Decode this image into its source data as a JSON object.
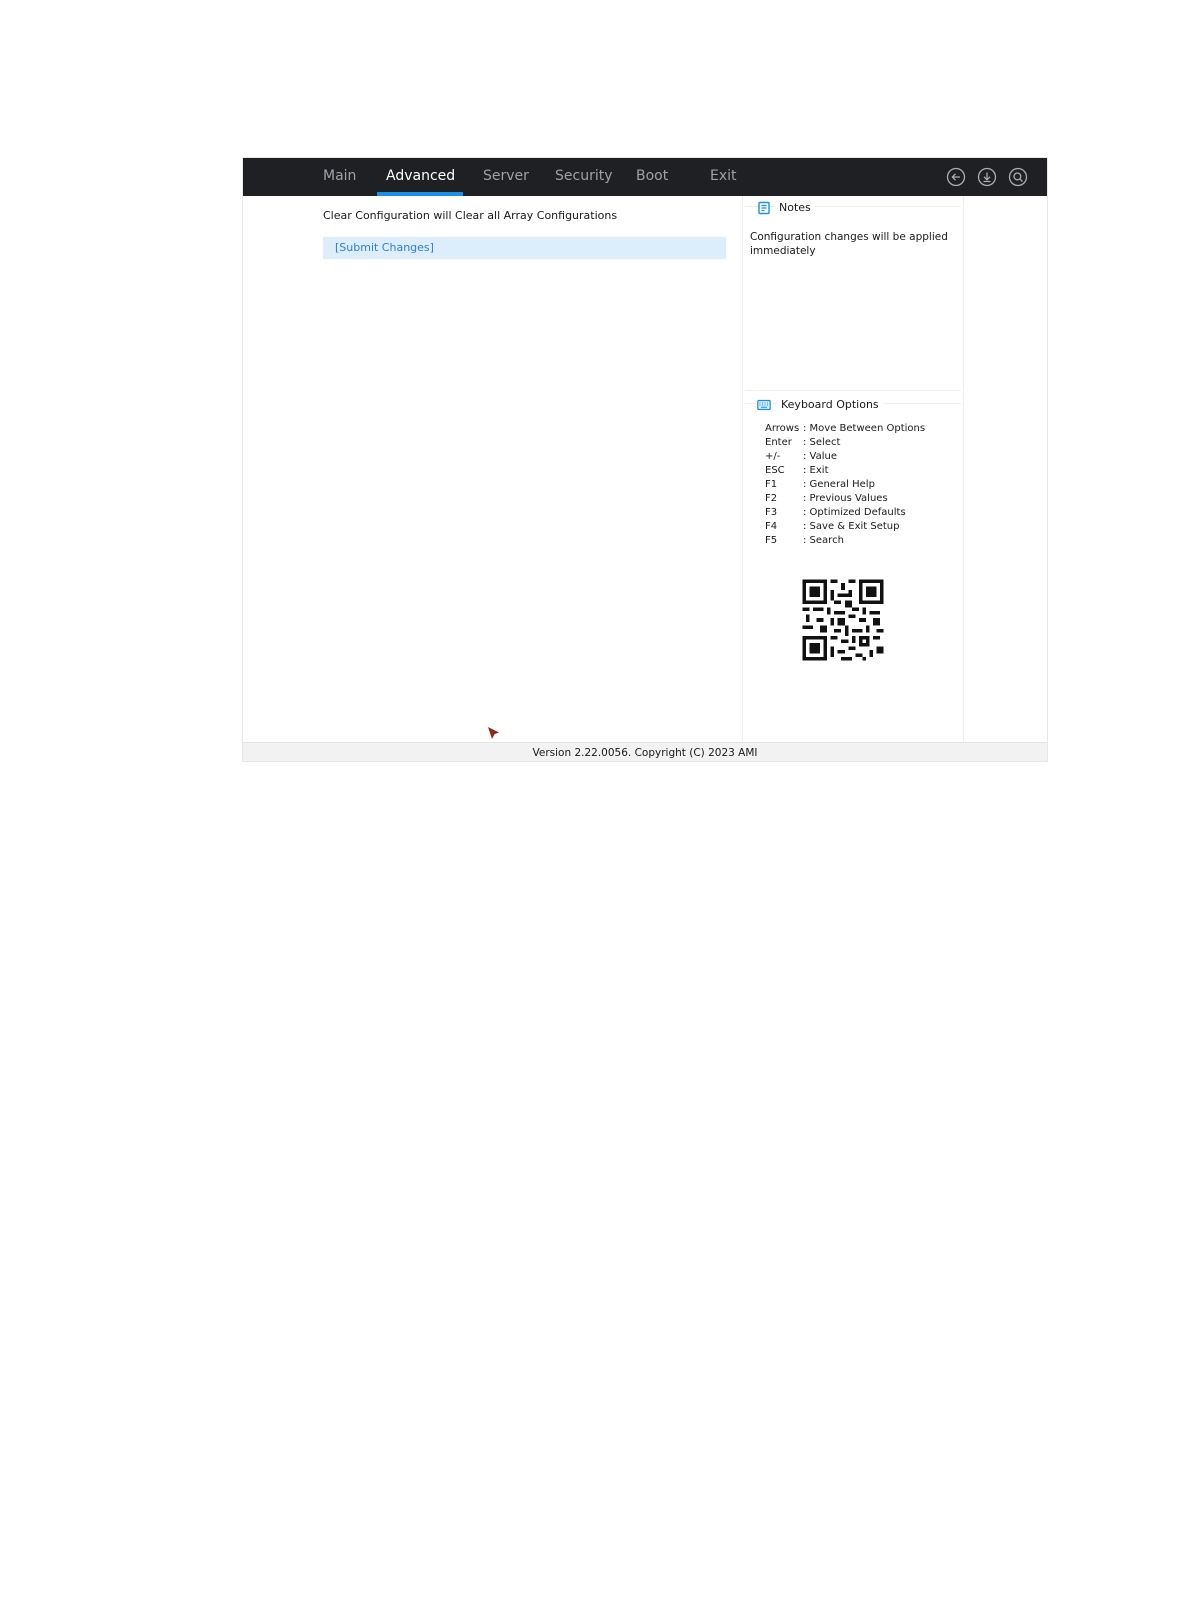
{
  "tabs": [
    {
      "label": "Main"
    },
    {
      "label": "Advanced"
    },
    {
      "label": "Server"
    },
    {
      "label": "Security"
    },
    {
      "label": "Boot"
    },
    {
      "label": "Exit"
    }
  ],
  "active_tab": "Advanced",
  "toolbar_icons": [
    "back-icon",
    "save-download-icon",
    "search-icon"
  ],
  "main": {
    "info_text": "Clear Configuration will Clear all Array Configurations",
    "submit_label": "[Submit Changes]"
  },
  "notes": {
    "title": "Notes",
    "text": "Configuration changes will be applied immediately"
  },
  "keyboard": {
    "title": "Keyboard Options",
    "rows": [
      {
        "key": "Arrows",
        "desc": ": Move Between Options"
      },
      {
        "key": "Enter",
        "desc": ": Select"
      },
      {
        "key": "+/-",
        "desc": ": Value"
      },
      {
        "key": "ESC",
        "desc": ": Exit"
      },
      {
        "key": "F1",
        "desc": ": General Help"
      },
      {
        "key": "F2",
        "desc": ": Previous Values"
      },
      {
        "key": "F3",
        "desc": ": Optimized Defaults"
      },
      {
        "key": "F4",
        "desc": ": Save & Exit Setup"
      },
      {
        "key": "F5",
        "desc": ": Search"
      }
    ]
  },
  "footer": {
    "text": "Version 2.22.0056. Copyright (C) 2023 AMI"
  },
  "colors": {
    "topbar": "#1e2023",
    "accent": "#1a8fe3",
    "selection": "#dcedfb",
    "link": "#2f7fd6"
  }
}
